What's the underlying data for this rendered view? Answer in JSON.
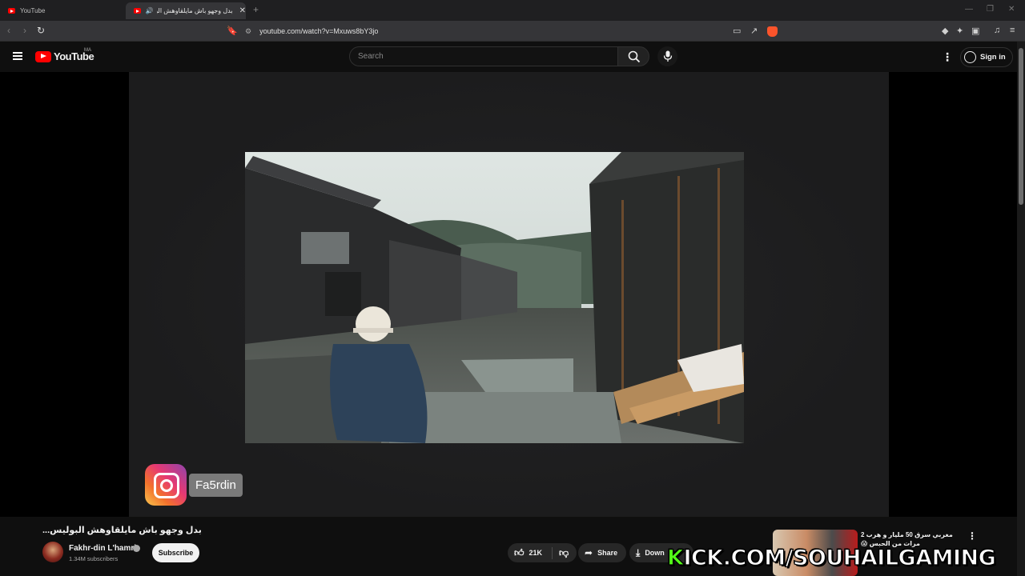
{
  "browser": {
    "tabs": [
      {
        "label": "YouTube"
      },
      {
        "label": "بدل وجهو باش مايلقاوهش البو"
      }
    ],
    "url": "youtube.com/watch?v=Mxuws8bY3jo"
  },
  "header": {
    "logo_text": "YouTube",
    "country_code": "MA",
    "search_placeholder": "Search",
    "sign_in_label": "Sign in"
  },
  "video": {
    "overlay_handle": "Fa5rdin",
    "title": "بدل وجهو باش مايلقاوهش البوليس...",
    "channel_name": "Fakhr-din L'hamri",
    "subscribers": "1.34M subscribers",
    "subscribe_label": "Subscribe",
    "likes": "21K",
    "share_label": "Share",
    "download_label": "Down"
  },
  "stream_overlay": {
    "prefix": "K",
    "text": "ICK.COM/SOUHAILGAMING"
  },
  "recommendation": {
    "title": "مغربي سرق 50 مليار و هرب 2 مرات من الحبس 😱"
  },
  "colors": {
    "brand_red": "#ff0000",
    "kick_green": "#53fc18",
    "background": "#0f0f0f"
  }
}
